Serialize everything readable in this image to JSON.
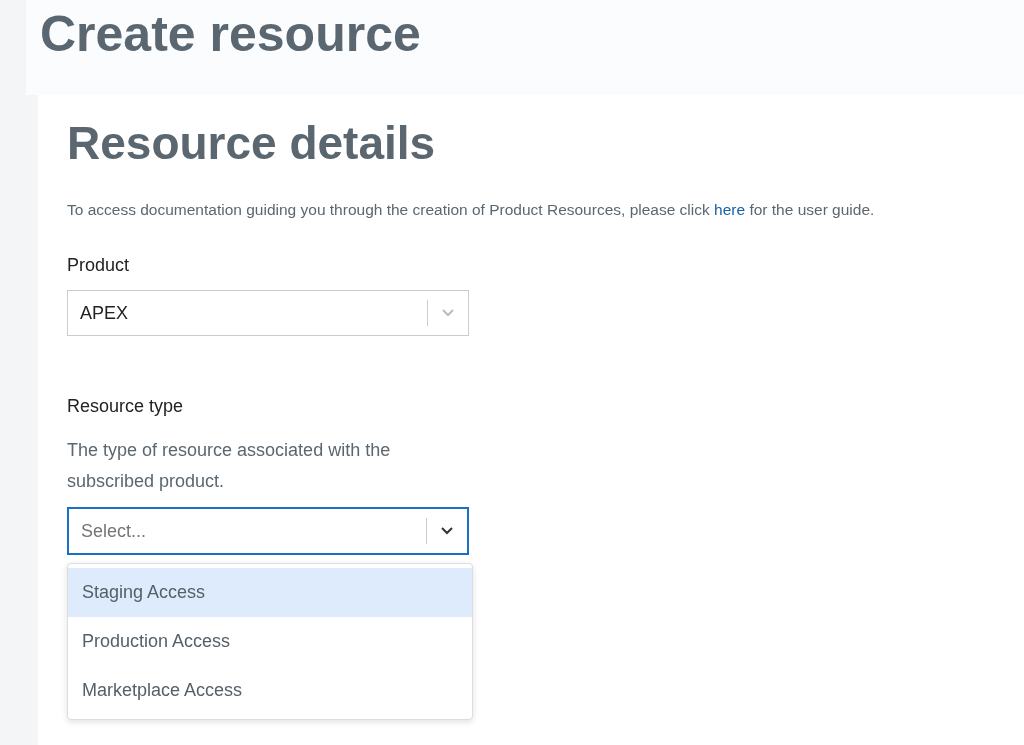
{
  "page_title": "Create resource",
  "section": {
    "title": "Resource details",
    "intro_before": "To access documentation guiding you through the creation of Product Resources, please click ",
    "intro_link": "here",
    "intro_after": " for the user guide."
  },
  "fields": [
    {
      "label": "Product",
      "value": "APEX",
      "focused": false
    },
    {
      "label": "Resource type",
      "help": "The type of resource associated with the subscribed product.",
      "placeholder": "Select...",
      "focused": true,
      "options": [
        {
          "label": "Staging Access",
          "selected": true
        },
        {
          "label": "Production Access",
          "selected": false
        },
        {
          "label": "Marketplace Access",
          "selected": false
        }
      ]
    }
  ]
}
